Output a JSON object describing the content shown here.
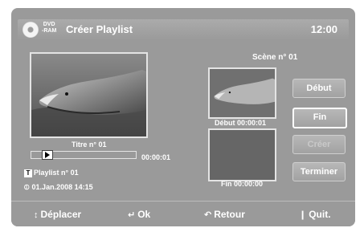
{
  "header": {
    "disc_label_top": "DVD",
    "disc_label_bottom": "-RAM",
    "title": "Créer Playlist",
    "clock": "12:00"
  },
  "scene_label": "Scène n° 01",
  "preview": {
    "title_label": "Titre n° 01",
    "time": "00:00:01",
    "progress": 0.05
  },
  "info": {
    "playlist": "Playlist n° 01",
    "playlist_icon": "T",
    "date": "01.Jan.2008  14:15"
  },
  "start_label": "Début 00:00:01",
  "end_label": "Fin 00:00:00",
  "buttons": {
    "debut": "Début",
    "fin": "Fin",
    "creer": "Créer",
    "terminer": "Terminer"
  },
  "bottom": {
    "deplacer": "Déplacer",
    "ok": "Ok",
    "retour": "Retour",
    "quit": "Quit."
  }
}
